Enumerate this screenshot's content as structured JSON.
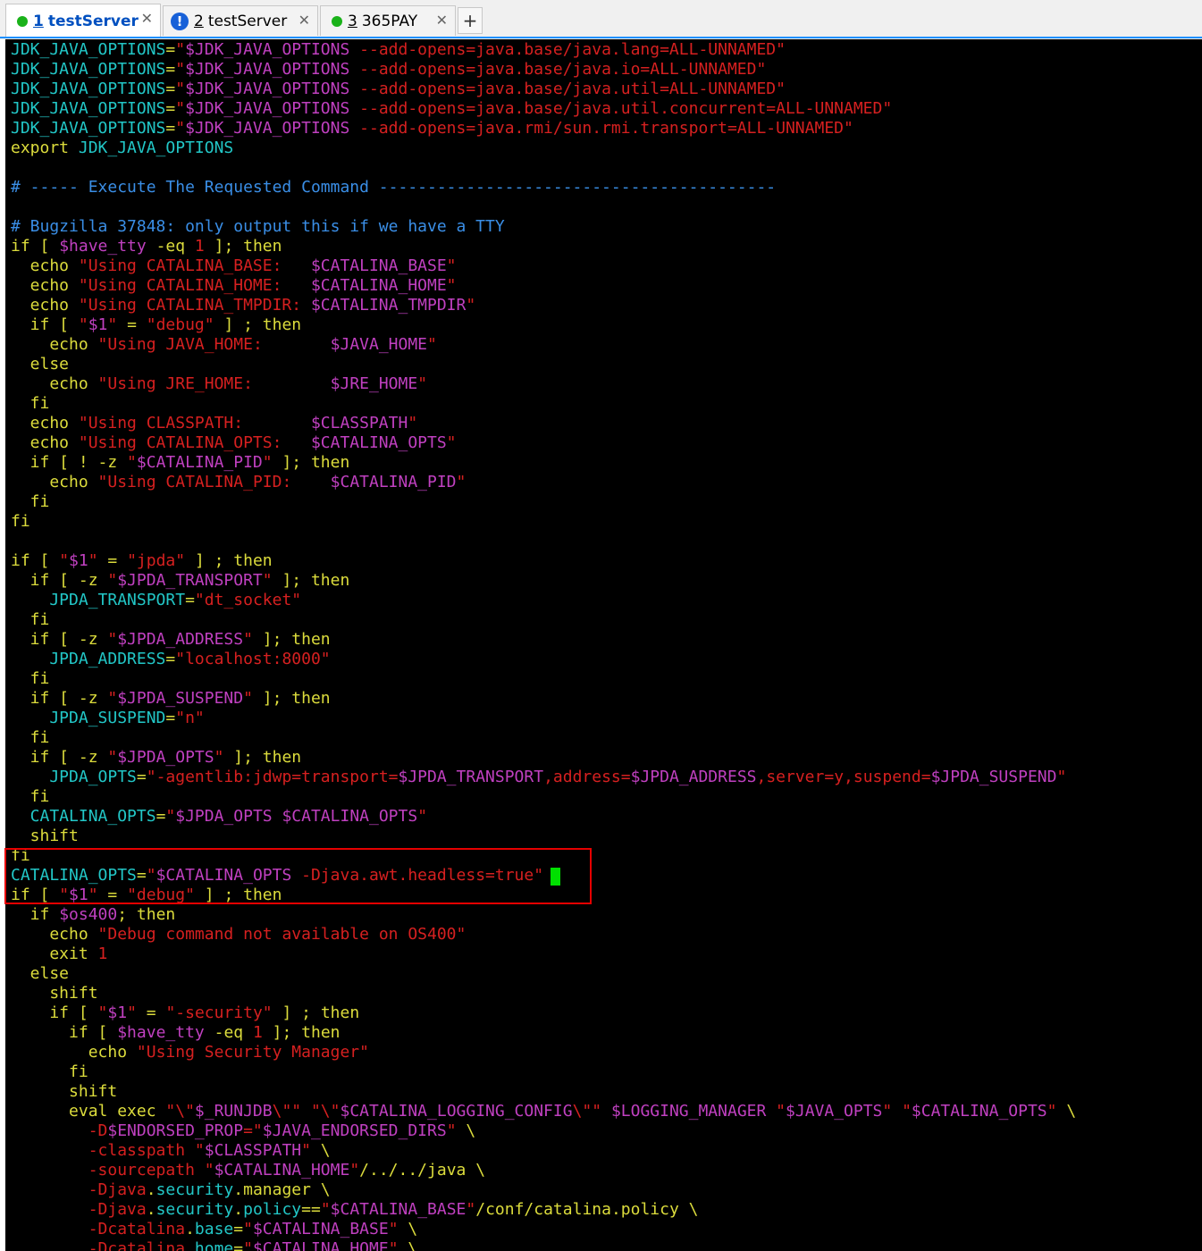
{
  "tabs": [
    {
      "number": "1",
      "title": "testServer",
      "status": "connected",
      "active": true,
      "close": "✕"
    },
    {
      "number": "2",
      "title": "testServer",
      "status": "warning",
      "active": false,
      "close": "✕"
    },
    {
      "number": "3",
      "title": "365PAY",
      "status": "connected",
      "active": false,
      "close": "✕"
    }
  ],
  "add_tab_label": "+",
  "colors": {
    "background": "#000000",
    "keyword": "#dcdc3c",
    "variable": "#22c7c7",
    "string": "#d62020",
    "substitution": "#c040c0",
    "comment": "#3a8ee6",
    "highlight_box": "#e60000",
    "cursor": "#00e000"
  },
  "terminal_lines": [
    [
      [
        "var",
        "JDK_JAVA_OPTIONS"
      ],
      [
        "plain",
        "="
      ],
      [
        "str",
        "\""
      ],
      [
        "sub",
        "$JDK_JAVA_OPTIONS"
      ],
      [
        "str",
        " --add-opens=java.base/java.lang=ALL-UNNAMED\""
      ]
    ],
    [
      [
        "var",
        "JDK_JAVA_OPTIONS"
      ],
      [
        "plain",
        "="
      ],
      [
        "str",
        "\""
      ],
      [
        "sub",
        "$JDK_JAVA_OPTIONS"
      ],
      [
        "str",
        " --add-opens=java.base/java.io=ALL-UNNAMED\""
      ]
    ],
    [
      [
        "var",
        "JDK_JAVA_OPTIONS"
      ],
      [
        "plain",
        "="
      ],
      [
        "str",
        "\""
      ],
      [
        "sub",
        "$JDK_JAVA_OPTIONS"
      ],
      [
        "str",
        " --add-opens=java.base/java.util=ALL-UNNAMED\""
      ]
    ],
    [
      [
        "var",
        "JDK_JAVA_OPTIONS"
      ],
      [
        "plain",
        "="
      ],
      [
        "str",
        "\""
      ],
      [
        "sub",
        "$JDK_JAVA_OPTIONS"
      ],
      [
        "str",
        " --add-opens=java.base/java.util.concurrent=ALL-UNNAMED\""
      ]
    ],
    [
      [
        "var",
        "JDK_JAVA_OPTIONS"
      ],
      [
        "plain",
        "="
      ],
      [
        "str",
        "\""
      ],
      [
        "sub",
        "$JDK_JAVA_OPTIONS"
      ],
      [
        "str",
        " --add-opens=java.rmi/sun.rmi.transport=ALL-UNNAMED\""
      ]
    ],
    [
      [
        "key",
        "export "
      ],
      [
        "var",
        "JDK_JAVA_OPTIONS"
      ]
    ],
    [],
    [
      [
        "cmt",
        "# ----- Execute The Requested Command -----------------------------------------"
      ]
    ],
    [],
    [
      [
        "cmt",
        "# Bugzilla 37848: only output this if we have a TTY"
      ]
    ],
    [
      [
        "key",
        "if [ "
      ],
      [
        "sub",
        "$have_tty"
      ],
      [
        "key",
        " -eq "
      ],
      [
        "num",
        "1"
      ],
      [
        "key",
        " ]; then"
      ]
    ],
    [
      [
        "key",
        "  echo "
      ],
      [
        "str",
        "\"Using CATALINA_BASE:   "
      ],
      [
        "sub",
        "$CATALINA_BASE"
      ],
      [
        "str",
        "\""
      ]
    ],
    [
      [
        "key",
        "  echo "
      ],
      [
        "str",
        "\"Using CATALINA_HOME:   "
      ],
      [
        "sub",
        "$CATALINA_HOME"
      ],
      [
        "str",
        "\""
      ]
    ],
    [
      [
        "key",
        "  echo "
      ],
      [
        "str",
        "\"Using CATALINA_TMPDIR: "
      ],
      [
        "sub",
        "$CATALINA_TMPDIR"
      ],
      [
        "str",
        "\""
      ]
    ],
    [
      [
        "key",
        "  if [ "
      ],
      [
        "str",
        "\""
      ],
      [
        "sub",
        "$1"
      ],
      [
        "str",
        "\""
      ],
      [
        "key",
        " = "
      ],
      [
        "str",
        "\"debug\""
      ],
      [
        "key",
        " ] ; then"
      ]
    ],
    [
      [
        "key",
        "    echo "
      ],
      [
        "str",
        "\"Using JAVA_HOME:       "
      ],
      [
        "sub",
        "$JAVA_HOME"
      ],
      [
        "str",
        "\""
      ]
    ],
    [
      [
        "key",
        "  else"
      ]
    ],
    [
      [
        "key",
        "    echo "
      ],
      [
        "str",
        "\"Using JRE_HOME:        "
      ],
      [
        "sub",
        "$JRE_HOME"
      ],
      [
        "str",
        "\""
      ]
    ],
    [
      [
        "key",
        "  fi"
      ]
    ],
    [
      [
        "key",
        "  echo "
      ],
      [
        "str",
        "\"Using CLASSPATH:       "
      ],
      [
        "sub",
        "$CLASSPATH"
      ],
      [
        "str",
        "\""
      ]
    ],
    [
      [
        "key",
        "  echo "
      ],
      [
        "str",
        "\"Using CATALINA_OPTS:   "
      ],
      [
        "sub",
        "$CATALINA_OPTS"
      ],
      [
        "str",
        "\""
      ]
    ],
    [
      [
        "key",
        "  if [ ! -z "
      ],
      [
        "str",
        "\""
      ],
      [
        "sub",
        "$CATALINA_PID"
      ],
      [
        "str",
        "\""
      ],
      [
        "key",
        " ]; then"
      ]
    ],
    [
      [
        "key",
        "    echo "
      ],
      [
        "str",
        "\"Using CATALINA_PID:    "
      ],
      [
        "sub",
        "$CATALINA_PID"
      ],
      [
        "str",
        "\""
      ]
    ],
    [
      [
        "key",
        "  fi"
      ]
    ],
    [
      [
        "key",
        "fi"
      ]
    ],
    [],
    [
      [
        "key",
        "if [ "
      ],
      [
        "str",
        "\""
      ],
      [
        "sub",
        "$1"
      ],
      [
        "str",
        "\""
      ],
      [
        "key",
        " = "
      ],
      [
        "str",
        "\"jpda\""
      ],
      [
        "key",
        " ] ; then"
      ]
    ],
    [
      [
        "key",
        "  if [ -z "
      ],
      [
        "str",
        "\""
      ],
      [
        "sub",
        "$JPDA_TRANSPORT"
      ],
      [
        "str",
        "\""
      ],
      [
        "key",
        " ]; then"
      ]
    ],
    [
      [
        "var",
        "    JPDA_TRANSPORT"
      ],
      [
        "plain",
        "="
      ],
      [
        "str",
        "\"dt_socket\""
      ]
    ],
    [
      [
        "key",
        "  fi"
      ]
    ],
    [
      [
        "key",
        "  if [ -z "
      ],
      [
        "str",
        "\""
      ],
      [
        "sub",
        "$JPDA_ADDRESS"
      ],
      [
        "str",
        "\""
      ],
      [
        "key",
        " ]; then"
      ]
    ],
    [
      [
        "var",
        "    JPDA_ADDRESS"
      ],
      [
        "plain",
        "="
      ],
      [
        "str",
        "\"localhost:8000\""
      ]
    ],
    [
      [
        "key",
        "  fi"
      ]
    ],
    [
      [
        "key",
        "  if [ -z "
      ],
      [
        "str",
        "\""
      ],
      [
        "sub",
        "$JPDA_SUSPEND"
      ],
      [
        "str",
        "\""
      ],
      [
        "key",
        " ]; then"
      ]
    ],
    [
      [
        "var",
        "    JPDA_SUSPEND"
      ],
      [
        "plain",
        "="
      ],
      [
        "str",
        "\"n\""
      ]
    ],
    [
      [
        "key",
        "  fi"
      ]
    ],
    [
      [
        "key",
        "  if [ -z "
      ],
      [
        "str",
        "\""
      ],
      [
        "sub",
        "$JPDA_OPTS"
      ],
      [
        "str",
        "\""
      ],
      [
        "key",
        " ]; then"
      ]
    ],
    [
      [
        "var",
        "    JPDA_OPTS"
      ],
      [
        "plain",
        "="
      ],
      [
        "str",
        "\"-agentlib:jdwp=transport="
      ],
      [
        "sub",
        "$JPDA_TRANSPORT"
      ],
      [
        "str",
        ",address="
      ],
      [
        "sub",
        "$JPDA_ADDRESS"
      ],
      [
        "str",
        ",server=y,suspend="
      ],
      [
        "sub",
        "$JPDA_SUSPEND"
      ],
      [
        "str",
        "\""
      ]
    ],
    [
      [
        "key",
        "  fi"
      ]
    ],
    [
      [
        "var",
        "  CATALINA_OPTS"
      ],
      [
        "plain",
        "="
      ],
      [
        "str",
        "\""
      ],
      [
        "sub",
        "$JPDA_OPTS $CATALINA_OPTS"
      ],
      [
        "str",
        "\""
      ]
    ],
    [
      [
        "key",
        "  shift"
      ]
    ],
    [
      [
        "key",
        "fi"
      ]
    ],
    [
      [
        "var",
        "CATALINA_OPTS"
      ],
      [
        "plain",
        "="
      ],
      [
        "str",
        "\""
      ],
      [
        "sub",
        "$CATALINA_OPTS"
      ],
      [
        "str",
        " -Djava.awt.headless=true\""
      ]
    ],
    [
      [
        "key",
        "if [ "
      ],
      [
        "str",
        "\""
      ],
      [
        "sub",
        "$1"
      ],
      [
        "str",
        "\""
      ],
      [
        "key",
        " = "
      ],
      [
        "str",
        "\"debug\""
      ],
      [
        "key",
        " ] ; then"
      ]
    ],
    [
      [
        "key",
        "  if "
      ],
      [
        "sub",
        "$os400"
      ],
      [
        "key",
        "; then"
      ]
    ],
    [
      [
        "key",
        "    echo "
      ],
      [
        "str",
        "\"Debug command not available on OS400\""
      ]
    ],
    [
      [
        "key",
        "    exit "
      ],
      [
        "num",
        "1"
      ]
    ],
    [
      [
        "key",
        "  else"
      ]
    ],
    [
      [
        "key",
        "    shift"
      ]
    ],
    [
      [
        "key",
        "    if [ "
      ],
      [
        "str",
        "\""
      ],
      [
        "sub",
        "$1"
      ],
      [
        "str",
        "\""
      ],
      [
        "key",
        " = "
      ],
      [
        "str",
        "\"-security\""
      ],
      [
        "key",
        " ] ; then"
      ]
    ],
    [
      [
        "key",
        "      if [ "
      ],
      [
        "sub",
        "$have_tty"
      ],
      [
        "key",
        " -eq "
      ],
      [
        "num",
        "1"
      ],
      [
        "key",
        " ]; then"
      ]
    ],
    [
      [
        "key",
        "        echo "
      ],
      [
        "str",
        "\"Using Security Manager\""
      ]
    ],
    [
      [
        "key",
        "      fi"
      ]
    ],
    [
      [
        "key",
        "      shift"
      ]
    ],
    [
      [
        "key",
        "      eval exec "
      ],
      [
        "str",
        "\"\\\""
      ],
      [
        "sub",
        "$_RUNJDB"
      ],
      [
        "str",
        "\\\"\""
      ],
      [
        "key",
        " "
      ],
      [
        "str",
        "\"\\\""
      ],
      [
        "sub",
        "$CATALINA_LOGGING_CONFIG"
      ],
      [
        "str",
        "\\\"\""
      ],
      [
        "key",
        " "
      ],
      [
        "sub",
        "$LOGGING_MANAGER"
      ],
      [
        "key",
        " "
      ],
      [
        "str",
        "\""
      ],
      [
        "sub",
        "$JAVA_OPTS"
      ],
      [
        "str",
        "\""
      ],
      [
        "key",
        " "
      ],
      [
        "str",
        "\""
      ],
      [
        "sub",
        "$CATALINA_OPTS"
      ],
      [
        "str",
        "\""
      ],
      [
        "key",
        " \\"
      ]
    ],
    [
      [
        "str",
        "        -D"
      ],
      [
        "sub",
        "$ENDORSED_PROP"
      ],
      [
        "str",
        "=\""
      ],
      [
        "sub",
        "$JAVA_ENDORSED_DIRS"
      ],
      [
        "str",
        "\""
      ],
      [
        "key",
        " \\"
      ]
    ],
    [
      [
        "str",
        "        -classpath "
      ],
      [
        "str",
        "\""
      ],
      [
        "sub",
        "$CLASSPATH"
      ],
      [
        "str",
        "\""
      ],
      [
        "key",
        " \\"
      ]
    ],
    [
      [
        "str",
        "        -sourcepath "
      ],
      [
        "str",
        "\""
      ],
      [
        "sub",
        "$CATALINA_HOME"
      ],
      [
        "str",
        "\""
      ],
      [
        "key",
        "/../../java \\"
      ]
    ],
    [
      [
        "str",
        "        -Djava"
      ],
      [
        "key",
        "."
      ],
      [
        "var",
        "security"
      ],
      [
        "key",
        ".manager \\"
      ]
    ],
    [
      [
        "str",
        "        -Djava"
      ],
      [
        "key",
        "."
      ],
      [
        "var",
        "security"
      ],
      [
        "key",
        "."
      ],
      [
        "var",
        "policy"
      ],
      [
        "key",
        "=="
      ],
      [
        "str",
        "\""
      ],
      [
        "sub",
        "$CATALINA_BASE"
      ],
      [
        "str",
        "\""
      ],
      [
        "key",
        "/conf/catalina.policy \\"
      ]
    ],
    [
      [
        "str",
        "        -Dcatalina"
      ],
      [
        "key",
        "."
      ],
      [
        "var",
        "base"
      ],
      [
        "key",
        "="
      ],
      [
        "str",
        "\""
      ],
      [
        "sub",
        "$CATALINA_BASE"
      ],
      [
        "str",
        "\""
      ],
      [
        "key",
        " \\"
      ]
    ],
    [
      [
        "str",
        "        -Dcatalina"
      ],
      [
        "key",
        "."
      ],
      [
        "var",
        "home"
      ],
      [
        "key",
        "="
      ],
      [
        "str",
        "\""
      ],
      [
        "sub",
        "$CATALINA_HOME"
      ],
      [
        "str",
        "\""
      ],
      [
        "key",
        " \\"
      ]
    ]
  ]
}
